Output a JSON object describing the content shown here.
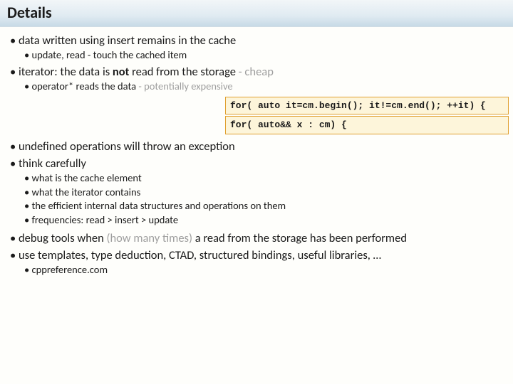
{
  "title": "Details",
  "b1": {
    "text": "data written using insert remains in the cache",
    "sub": [
      "update, read - touch the cached item"
    ]
  },
  "b2": {
    "part1": "iterator: the data is ",
    "bold": "not",
    "part2": " read from the storage",
    "faint": " - cheap",
    "sub_part1": "operator* reads the data",
    "sub_faint": " - potentially expensive"
  },
  "code": {
    "line1": "for( auto it=cm.begin(); it!=cm.end(); ++it) {",
    "line2": "for( auto&& x : cm) {"
  },
  "b3": "undefined operations will throw an exception",
  "b4": {
    "text": "think carefully",
    "sub": [
      "what is the cache element",
      "what the iterator contains",
      "the efficient internal data structures and operations on them"
    ],
    "subsub": "frequencies: read > insert > update"
  },
  "b5": {
    "part1": "debug tools when ",
    "faint": "(how many times)",
    "part2": " a read from the storage has been performed"
  },
  "b6": {
    "text": "use templates, type deduction, CTAD, structured bindings, useful libraries, …",
    "sub": [
      "cppreference.com"
    ]
  }
}
